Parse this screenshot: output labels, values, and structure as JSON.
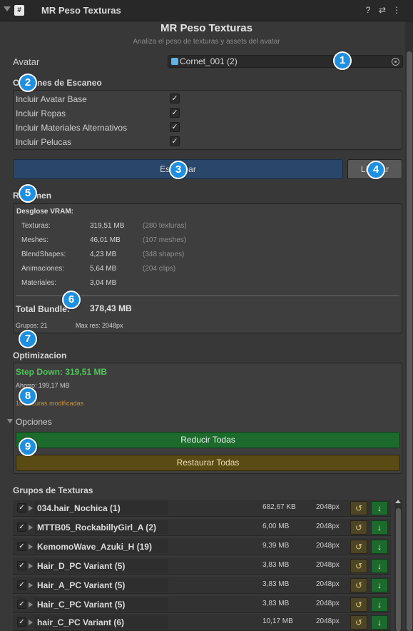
{
  "window": {
    "title": "MR Peso Texturas"
  },
  "header": {
    "title": "MR Peso Texturas",
    "subtitle": "Analiza el peso de texturas y assets del avatar"
  },
  "avatar": {
    "label": "Avatar",
    "value": "Cornet_001 (2)"
  },
  "scan_options": {
    "title": "Opciones de Escaneo",
    "items": [
      {
        "label": "Incluir Avatar Base",
        "checked": true
      },
      {
        "label": "Incluir Ropas",
        "checked": true
      },
      {
        "label": "Incluir Materiales Alternativos",
        "checked": true
      },
      {
        "label": "Incluir Pelucas",
        "checked": true
      }
    ]
  },
  "buttons": {
    "scan": "Escanear",
    "clear": "Limpiar"
  },
  "summary": {
    "title": "Resumen",
    "breakdown_title": "Desglose VRAM:",
    "rows": [
      {
        "label": "Texturas:",
        "value": "319,51 MB",
        "note": "(280 texturas)"
      },
      {
        "label": "Meshes:",
        "value": "46,01 MB",
        "note": "(107 meshes)"
      },
      {
        "label": "BlendShapes:",
        "value": "4,23 MB",
        "note": "(348 shapes)"
      },
      {
        "label": "Animaciones:",
        "value": "5,64 MB",
        "note": "(204 clips)"
      },
      {
        "label": "Materiales:",
        "value": "3,04 MB",
        "note": ""
      }
    ],
    "total_label": "Total Bundle:",
    "total_value": "378,43 MB",
    "groups": "Grupos: 21",
    "max_res": "Max res: 2048px"
  },
  "optimization": {
    "title": "Optimizacion",
    "step_down": "Step Down: 319,51 MB",
    "savings": "Ahorro: 199,17 MB",
    "modified": "10 texturas modificadas",
    "options_label": "Opciones",
    "reduce_all": "Reducir Todas",
    "restore_all": "Restaurar Todas"
  },
  "groups": {
    "title": "Grupos de Texturas",
    "items": [
      {
        "name": "034.hair_Nochica (1)",
        "size": "682,67 KB",
        "res": "2048px"
      },
      {
        "name": "MTTB05_RockabillyGirl_A (2)",
        "size": "6,00 MB",
        "res": "2048px"
      },
      {
        "name": "KemomoWave_Azuki_H (19)",
        "size": "9,39 MB",
        "res": "2048px"
      },
      {
        "name": "Hair_D_PC Variant (5)",
        "size": "3,83 MB",
        "res": "2048px"
      },
      {
        "name": "Hair_A_PC Variant (5)",
        "size": "3,83 MB",
        "res": "2048px"
      },
      {
        "name": "Hair_C_PC Variant (5)",
        "size": "3,83 MB",
        "res": "2048px"
      },
      {
        "name": "hair_C_PC Variant (6)",
        "size": "10,17 MB",
        "res": "2048px"
      }
    ]
  },
  "badges": [
    "1",
    "2",
    "3",
    "4",
    "5",
    "6",
    "7",
    "8",
    "9"
  ],
  "colors": {
    "accent_badge": "#1f8fe0",
    "scan_button": "#2a4668",
    "step_down_green": "#4fc35a",
    "modified_orange": "#c7913a",
    "reduce_green": "#1c6a2c",
    "restore_gold": "#5a4a14"
  }
}
